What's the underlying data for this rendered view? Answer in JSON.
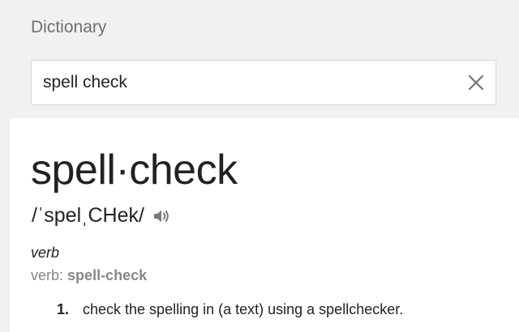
{
  "widget": {
    "title": "Dictionary"
  },
  "search": {
    "value": "spell check",
    "clear_icon": "close-icon"
  },
  "entry": {
    "headword": "spell·check",
    "phonetic": "/ˈspelˌCHek/",
    "audio_icon": "speaker-icon",
    "part_of_speech": "verb",
    "forms_label": "verb:",
    "forms_value": "spell-check",
    "senses": [
      {
        "number": "1.",
        "definition": "check the spelling in (a text) using a spellchecker."
      }
    ]
  },
  "colors": {
    "background": "#f1f1f1",
    "card": "#ffffff",
    "muted_text": "#878787",
    "primary_text": "#222222"
  }
}
